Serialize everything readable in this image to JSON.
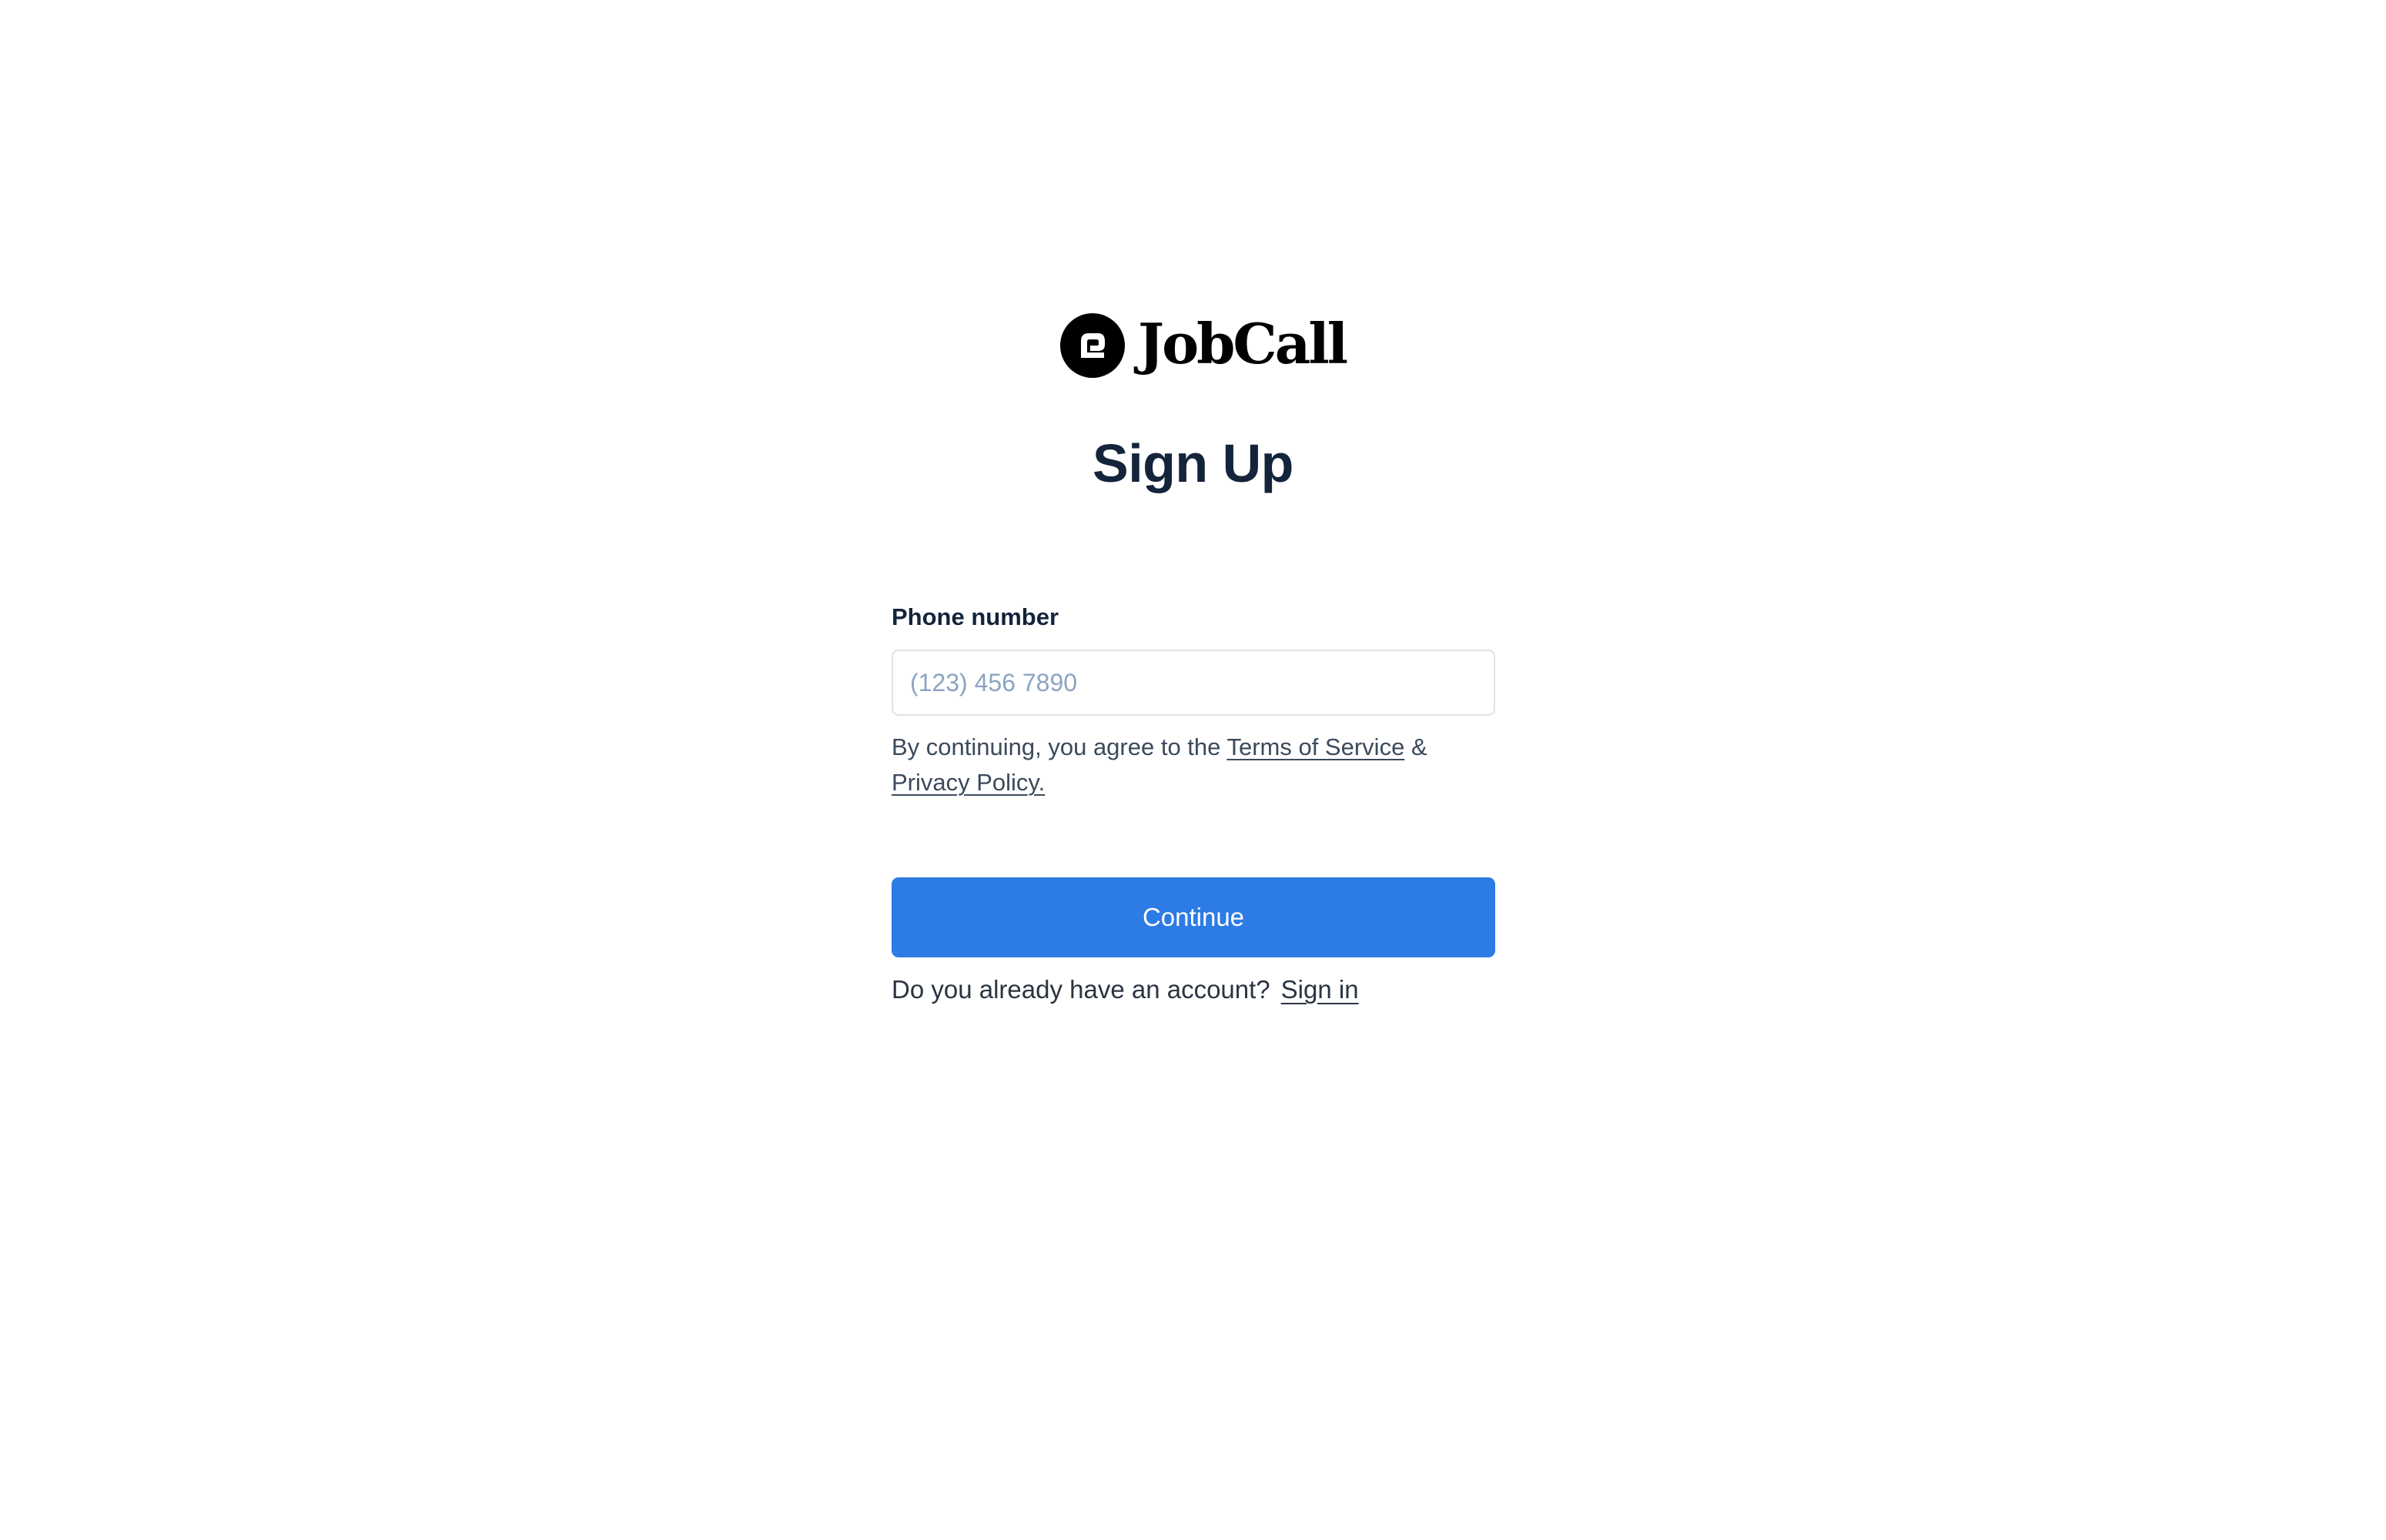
{
  "brand": {
    "name": "JobCall",
    "icon": "jobcall-logo-icon"
  },
  "page": {
    "title": "Sign Up"
  },
  "form": {
    "phone_label": "Phone number",
    "phone_placeholder": "(123) 456 7890",
    "phone_value": ""
  },
  "terms": {
    "prefix": "By continuing, you agree to the",
    "terms_link": "Terms of Service",
    "joiner": "&",
    "privacy_link": "Privacy Policy."
  },
  "actions": {
    "continue_label": "Continue",
    "continue_color": "#2d7be5"
  },
  "signin": {
    "prompt": "Do you already have an account?",
    "link": "Sign in"
  }
}
